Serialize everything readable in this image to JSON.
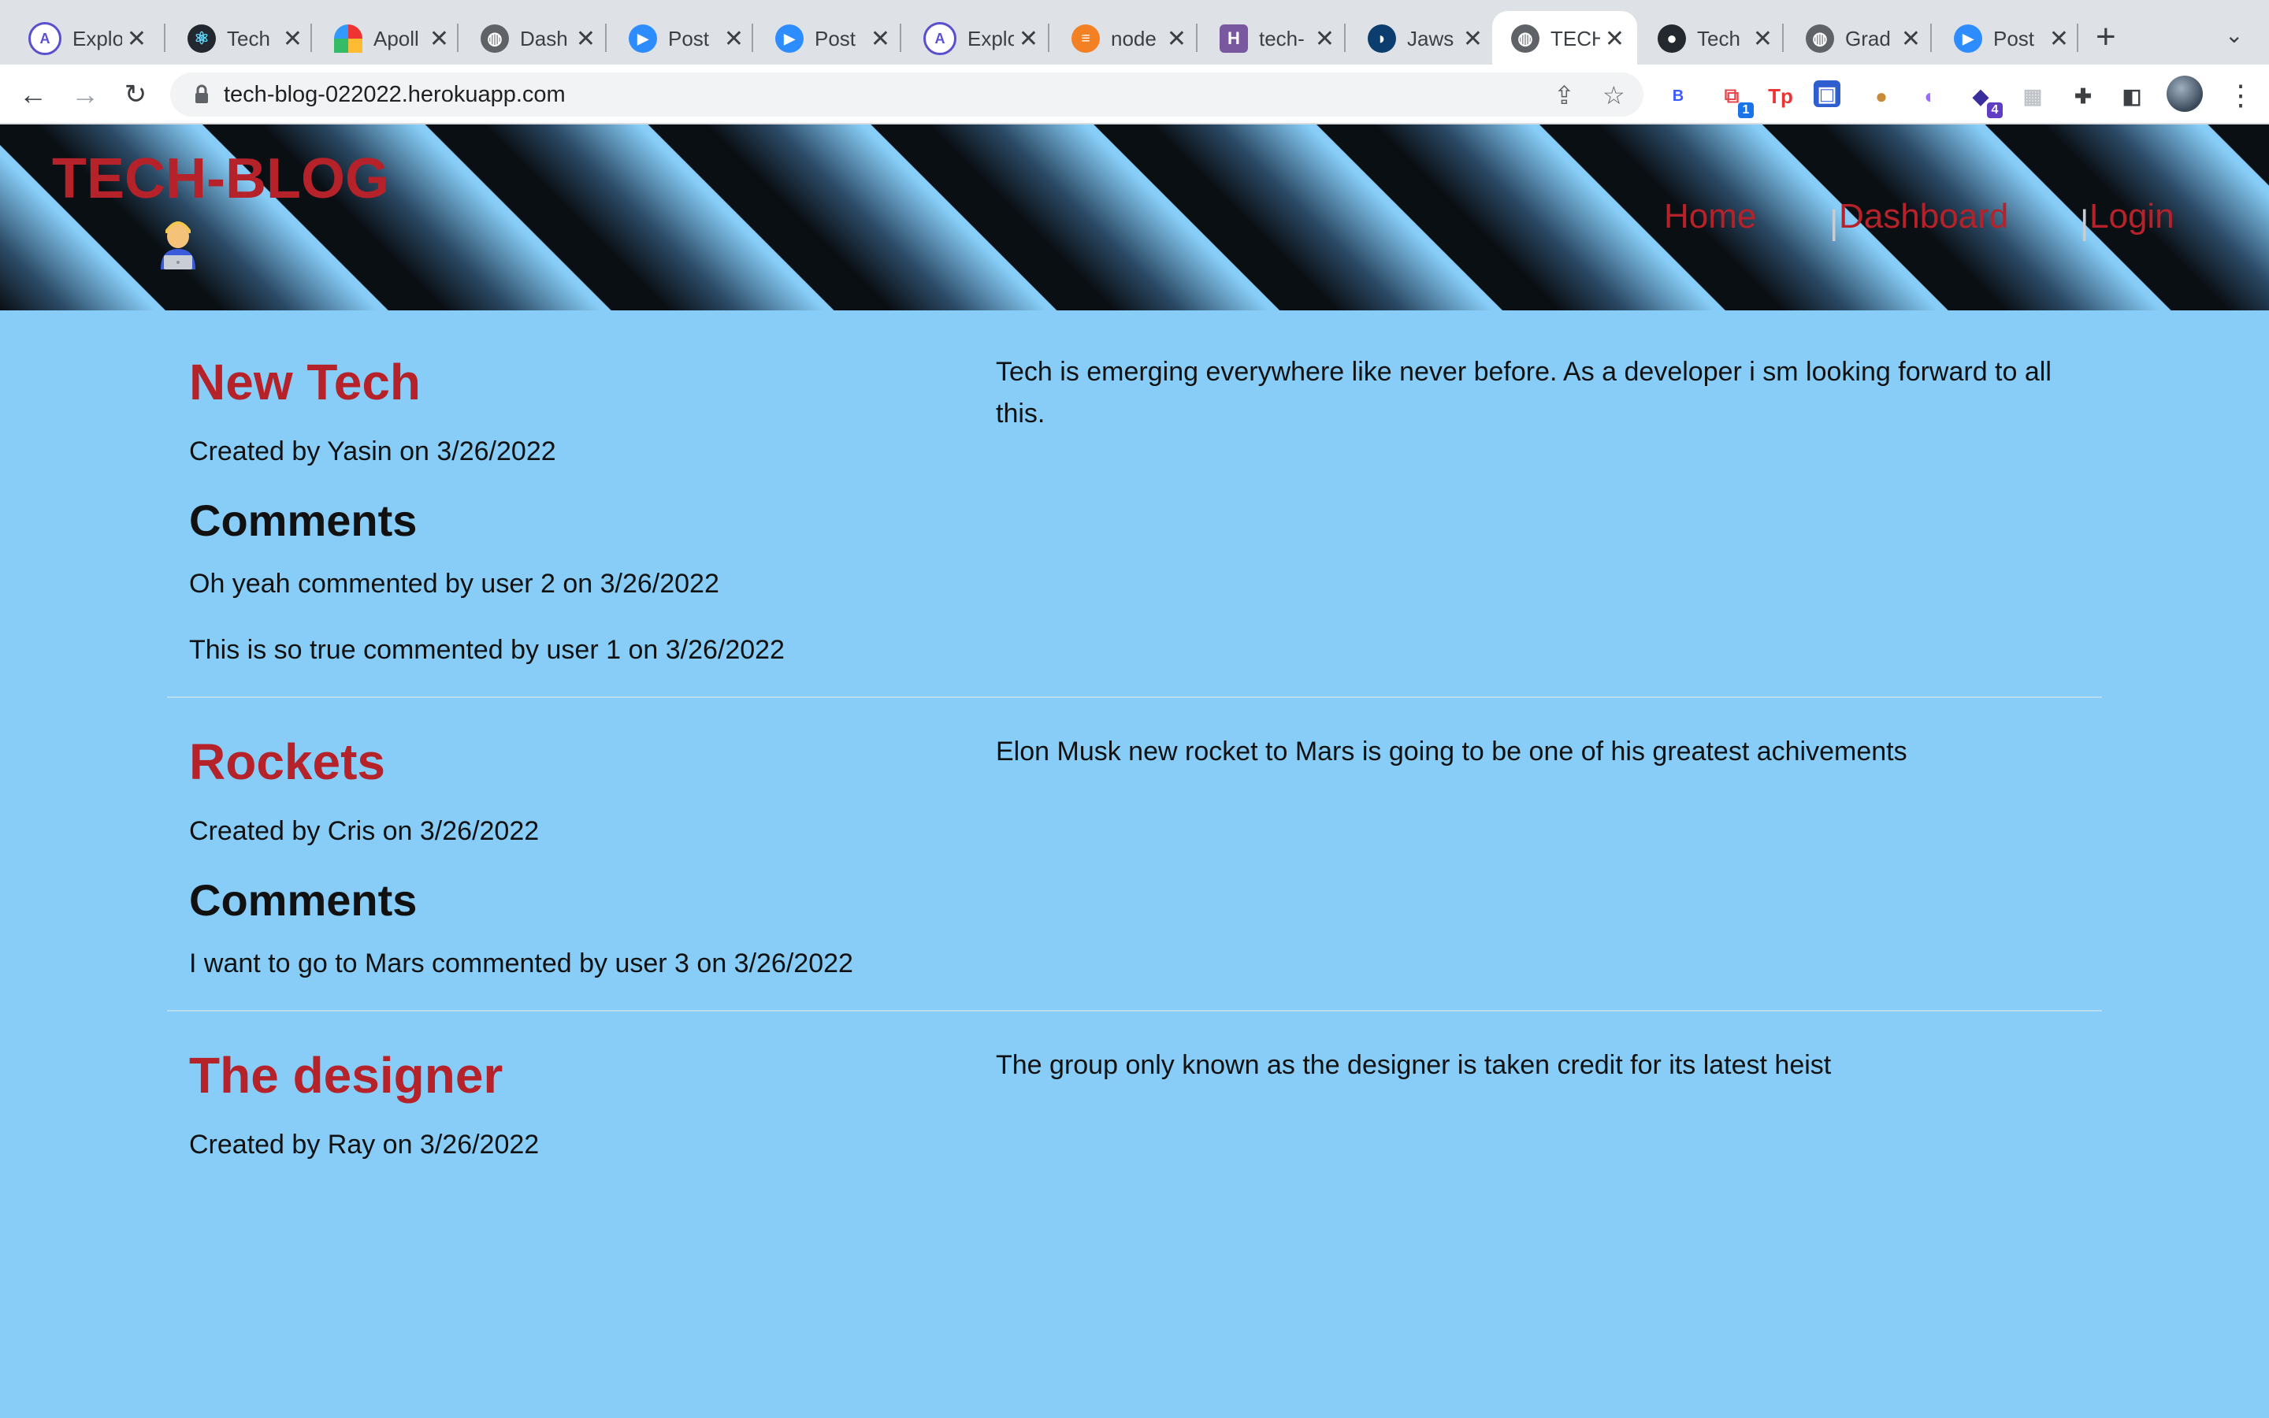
{
  "browser": {
    "tabs": [
      {
        "title": "Explo",
        "icon": "apollo-icon"
      },
      {
        "title": "Tech",
        "icon": "react-icon"
      },
      {
        "title": "Apoll",
        "icon": "rainbow-icon"
      },
      {
        "title": "Dash",
        "icon": "globe-icon"
      },
      {
        "title": "Post",
        "icon": "zoom-icon"
      },
      {
        "title": "Post",
        "icon": "zoom-icon"
      },
      {
        "title": "Explo",
        "icon": "apollo-icon"
      },
      {
        "title": "node",
        "icon": "stackoverflow-icon"
      },
      {
        "title": "tech-",
        "icon": "heroku-icon"
      },
      {
        "title": "Jaws",
        "icon": "jawsdb-icon"
      },
      {
        "title": "TECH",
        "icon": "globe-icon",
        "active": true
      },
      {
        "title": "Tech",
        "icon": "github-icon"
      },
      {
        "title": "Grad",
        "icon": "globe-icon"
      },
      {
        "title": "Post",
        "icon": "zoom-icon"
      }
    ],
    "url": "tech-blog-022022.herokuapp.com",
    "extension_badges": [
      "1",
      "4"
    ],
    "extension_letter": "B"
  },
  "site": {
    "brand": "TECH-BLOG",
    "brand_emoji_icon": "technologist-icon",
    "nav": {
      "home": "Home",
      "dashboard": "Dashboard",
      "login": "Login",
      "separator": "|"
    }
  },
  "posts": [
    {
      "title": "New Tech",
      "meta": "Created by Yasin on 3/26/2022",
      "body": "Tech is emerging everywhere like never before. As a developer i sm looking forward to all this.",
      "comments_heading": "Comments",
      "comments": [
        "Oh yeah commented by user 2 on 3/26/2022",
        "This is so true commented by user 1 on 3/26/2022"
      ]
    },
    {
      "title": "Rockets",
      "meta": "Created by Cris on 3/26/2022",
      "body": "Elon Musk new rocket to Mars is going to be one of his greatest achivements",
      "comments_heading": "Comments",
      "comments": [
        "I want to go to Mars commented by user 3 on 3/26/2022"
      ]
    },
    {
      "title": "The designer",
      "meta": "Created by Ray on 3/26/2022",
      "body": "The group only known as the designer is taken credit for its latest heist"
    }
  ],
  "colors": {
    "accent": "#b62229",
    "page_bg": "#87cdf7"
  }
}
